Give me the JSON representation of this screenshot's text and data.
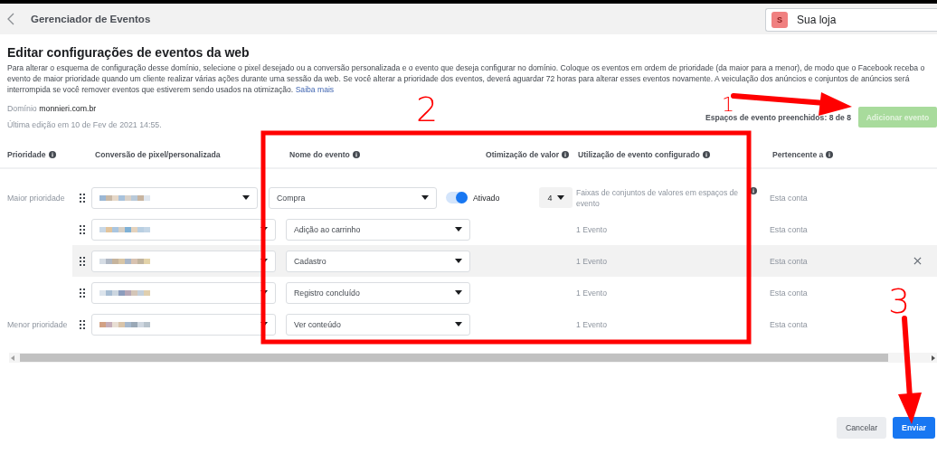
{
  "header": {
    "title": "Gerenciador de Eventos",
    "store": {
      "initial": "S",
      "name": "Sua loja"
    }
  },
  "page": {
    "title": "Editar configurações de eventos da web",
    "description": "Para alterar o esquema de configuração desse domínio, selecione o pixel desejado ou a conversão personalizada e o evento que deseja configurar no domínio. Coloque os eventos em ordem de prioridade (da maior para a menor), de modo que o Facebook receba o evento de maior prioridade quando um cliente realizar várias ações durante uma sessão da web. Se você alterar a prioridade dos eventos, deverá aguardar 72 horas para alterar esses eventos novamente. A veiculação dos anúncios e conjuntos de anúncios será interrompida se você remover eventos que estiverem sendo usados na otimização.",
    "link": "Saiba mais"
  },
  "domain": {
    "label": "Domínio",
    "value": "monnieri.com.br"
  },
  "last_edit": "Última edição em 10 de Fev de 2021 14:55.",
  "slots": "Espaços de evento preenchidos: 8 de 8",
  "add_button": {
    "label": "Adicionar evento",
    "disabled": true
  },
  "columns": [
    {
      "label": "Prioridade",
      "info": true
    },
    {
      "label": "Conversão de pixel/personalizada",
      "info": false
    },
    {
      "label": "Nome do evento",
      "info": true
    },
    {
      "label": "Otimização de valor",
      "info": true
    },
    {
      "label": "Utilização de evento configurado",
      "info": true
    },
    {
      "label": "Pertencente a",
      "info": true
    }
  ],
  "rows": [
    {
      "kind": "primary",
      "priority": "Maior prioridade",
      "event": "Compra",
      "toggle": {
        "on": true,
        "label": "Ativado"
      },
      "value_sets": "4",
      "usage": "Faixas de conjuntos de valores em espaços de evento",
      "usage_info": true,
      "belongs": "Esta conta",
      "hovered": false
    },
    {
      "kind": "standard",
      "event": "Adição ao carrinho",
      "usage": "1 Evento",
      "usage_info": false,
      "belongs": "Esta conta",
      "hovered": false
    },
    {
      "kind": "standard",
      "event": "Cadastro",
      "usage": "1 Evento",
      "usage_info": false,
      "belongs": "Esta conta",
      "hovered": true
    },
    {
      "kind": "standard",
      "event": "Registro concluído",
      "usage": "1 Evento",
      "usage_info": false,
      "belongs": "Esta conta",
      "hovered": false
    },
    {
      "kind": "standard",
      "priority": "Menor prioridade",
      "event": "Ver conteúdo",
      "usage": "1 Evento",
      "usage_info": false,
      "belongs": "Esta conta",
      "hovered": false
    }
  ],
  "footer": {
    "buttons": [
      {
        "label": "Cancelar",
        "kind": "secondary"
      },
      {
        "label": "Enviar",
        "kind": "primary"
      }
    ]
  },
  "annotations": [
    {
      "label": "1"
    },
    {
      "label": "2"
    },
    {
      "label": "3"
    }
  ]
}
